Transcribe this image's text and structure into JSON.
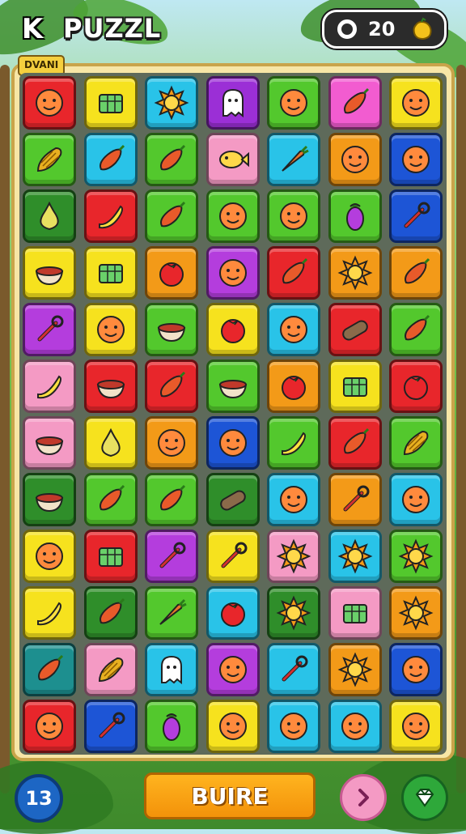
{
  "header": {
    "back_label": "K",
    "title": "PUZZL",
    "score": "20",
    "coin_icon": "coin-icon",
    "fruit_icon": "lemon-icon"
  },
  "board": {
    "label": "DVANI",
    "rows": [
      [
        {
          "c": "#e8262b",
          "i": "face"
        },
        {
          "c": "#f6e21e",
          "i": "box"
        },
        {
          "c": "#29c3e8",
          "i": "sun"
        },
        {
          "c": "#9b2fd6",
          "i": "ghost"
        },
        {
          "c": "#53c82d",
          "i": "face"
        },
        {
          "c": "#f25cd0",
          "i": "pepper"
        },
        {
          "c": "#f6e21e",
          "i": "face"
        }
      ],
      [
        {
          "c": "#53c82d",
          "i": "corn"
        },
        {
          "c": "#29c3e8",
          "i": "pepper"
        },
        {
          "c": "#53c82d",
          "i": "pepper"
        },
        {
          "c": "#f49ac4",
          "i": "fish"
        },
        {
          "c": "#29c3e8",
          "i": "carrot"
        },
        {
          "c": "#f39a18",
          "i": "face"
        },
        {
          "c": "#1d55d6",
          "i": "face"
        }
      ],
      [
        {
          "c": "#2f8e2a",
          "i": "pear"
        },
        {
          "c": "#e8262b",
          "i": "banana"
        },
        {
          "c": "#53c82d",
          "i": "pepper"
        },
        {
          "c": "#53c82d",
          "i": "face"
        },
        {
          "c": "#53c82d",
          "i": "face"
        },
        {
          "c": "#53c82d",
          "i": "eggplant"
        },
        {
          "c": "#1d55d6",
          "i": "tool"
        }
      ],
      [
        {
          "c": "#f6e21e",
          "i": "bowl"
        },
        {
          "c": "#f6e21e",
          "i": "box"
        },
        {
          "c": "#f39a18",
          "i": "tomato"
        },
        {
          "c": "#b43ddd",
          "i": "face"
        },
        {
          "c": "#e8262b",
          "i": "pepper"
        },
        {
          "c": "#f39a18",
          "i": "sun"
        },
        {
          "c": "#f39a18",
          "i": "pepper"
        }
      ],
      [
        {
          "c": "#b43ddd",
          "i": "tool"
        },
        {
          "c": "#f6e21e",
          "i": "face"
        },
        {
          "c": "#53c82d",
          "i": "bowl"
        },
        {
          "c": "#f6e21e",
          "i": "tomato"
        },
        {
          "c": "#29c3e8",
          "i": "face"
        },
        {
          "c": "#e8262b",
          "i": "log"
        },
        {
          "c": "#53c82d",
          "i": "pepper"
        }
      ],
      [
        {
          "c": "#f49ac4",
          "i": "banana"
        },
        {
          "c": "#e8262b",
          "i": "bowl"
        },
        {
          "c": "#e8262b",
          "i": "pepper"
        },
        {
          "c": "#53c82d",
          "i": "bowl"
        },
        {
          "c": "#f39a18",
          "i": "tomato"
        },
        {
          "c": "#f6e21e",
          "i": "box"
        },
        {
          "c": "#e8262b",
          "i": "tomato"
        }
      ],
      [
        {
          "c": "#f49ac4",
          "i": "bowl"
        },
        {
          "c": "#f6e21e",
          "i": "pear"
        },
        {
          "c": "#f39a18",
          "i": "face"
        },
        {
          "c": "#1d55d6",
          "i": "face"
        },
        {
          "c": "#53c82d",
          "i": "banana"
        },
        {
          "c": "#e8262b",
          "i": "pepper"
        },
        {
          "c": "#53c82d",
          "i": "corn"
        }
      ],
      [
        {
          "c": "#2f8e2a",
          "i": "bowl"
        },
        {
          "c": "#53c82d",
          "i": "pepper"
        },
        {
          "c": "#53c82d",
          "i": "pepper"
        },
        {
          "c": "#2f8e2a",
          "i": "log"
        },
        {
          "c": "#29c3e8",
          "i": "face"
        },
        {
          "c": "#f39a18",
          "i": "tool"
        },
        {
          "c": "#29c3e8",
          "i": "face"
        }
      ],
      [
        {
          "c": "#f6e21e",
          "i": "face"
        },
        {
          "c": "#e8262b",
          "i": "box"
        },
        {
          "c": "#b43ddd",
          "i": "tool"
        },
        {
          "c": "#f6e21e",
          "i": "tool"
        },
        {
          "c": "#f49ac4",
          "i": "sun"
        },
        {
          "c": "#29c3e8",
          "i": "sun"
        },
        {
          "c": "#53c82d",
          "i": "sun"
        }
      ],
      [
        {
          "c": "#f6e21e",
          "i": "banana"
        },
        {
          "c": "#2f8e2a",
          "i": "pepper"
        },
        {
          "c": "#53c82d",
          "i": "carrot"
        },
        {
          "c": "#29c3e8",
          "i": "tomato"
        },
        {
          "c": "#2f8e2a",
          "i": "sun"
        },
        {
          "c": "#f49ac4",
          "i": "box"
        },
        {
          "c": "#f39a18",
          "i": "sun"
        }
      ],
      [
        {
          "c": "#1d8f8f",
          "i": "pepper"
        },
        {
          "c": "#f49ac4",
          "i": "corn"
        },
        {
          "c": "#29c3e8",
          "i": "ghost"
        },
        {
          "c": "#b43ddd",
          "i": "face"
        },
        {
          "c": "#29c3e8",
          "i": "tool"
        },
        {
          "c": "#f39a18",
          "i": "sun"
        },
        {
          "c": "#1d55d6",
          "i": "face"
        }
      ],
      [
        {
          "c": "#e8262b",
          "i": "face"
        },
        {
          "c": "#1d55d6",
          "i": "tool"
        },
        {
          "c": "#53c82d",
          "i": "eggplant"
        },
        {
          "c": "#f6e21e",
          "i": "face"
        },
        {
          "c": "#29c3e8",
          "i": "face"
        },
        {
          "c": "#29c3e8",
          "i": "face"
        },
        {
          "c": "#f6e21e",
          "i": "face"
        }
      ]
    ]
  },
  "footer": {
    "level": "13",
    "main_button": "BUIRE",
    "next_icon": "chevron-right-icon",
    "gem_icon": "gem-icon"
  }
}
